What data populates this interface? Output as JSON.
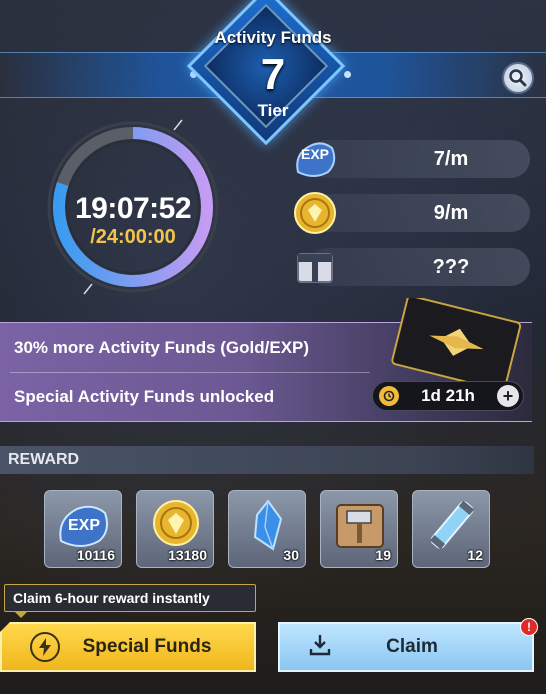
{
  "header": {
    "title": "Activity Funds",
    "tier_number": "7",
    "tier_label": "Tier"
  },
  "timer": {
    "elapsed": "19:07:52",
    "total": "/24:00:00",
    "progress_fraction": 0.8
  },
  "rates": [
    {
      "icon": "exp-icon",
      "value": "7/m"
    },
    {
      "icon": "gold-coin-icon",
      "value": "9/m"
    },
    {
      "icon": "mystery-box-icon",
      "value": "???"
    }
  ],
  "bonus": {
    "line1": "30% more Activity Funds (Gold/EXP)",
    "line2": "Special Activity Funds unlocked",
    "remaining": "1d 21h"
  },
  "reward": {
    "label": "REWARD",
    "items": [
      {
        "icon": "exp-icon",
        "qty": "10116"
      },
      {
        "icon": "gold-coin-icon",
        "qty": "13180"
      },
      {
        "icon": "blue-crystal-icon",
        "qty": "30"
      },
      {
        "icon": "hammer-icon",
        "qty": "19"
      },
      {
        "icon": "energy-tube-icon",
        "qty": "12"
      }
    ]
  },
  "footer": {
    "tooltip": "Claim 6-hour reward instantly",
    "special_label": "Special Funds",
    "claim_label": "Claim",
    "claim_badge": "!"
  },
  "colors": {
    "gold": "#f4c44a",
    "ring_blue": "#3a9cf0",
    "ring_purple": "#c49cf2",
    "bonus_purple": "#7b63a5"
  }
}
